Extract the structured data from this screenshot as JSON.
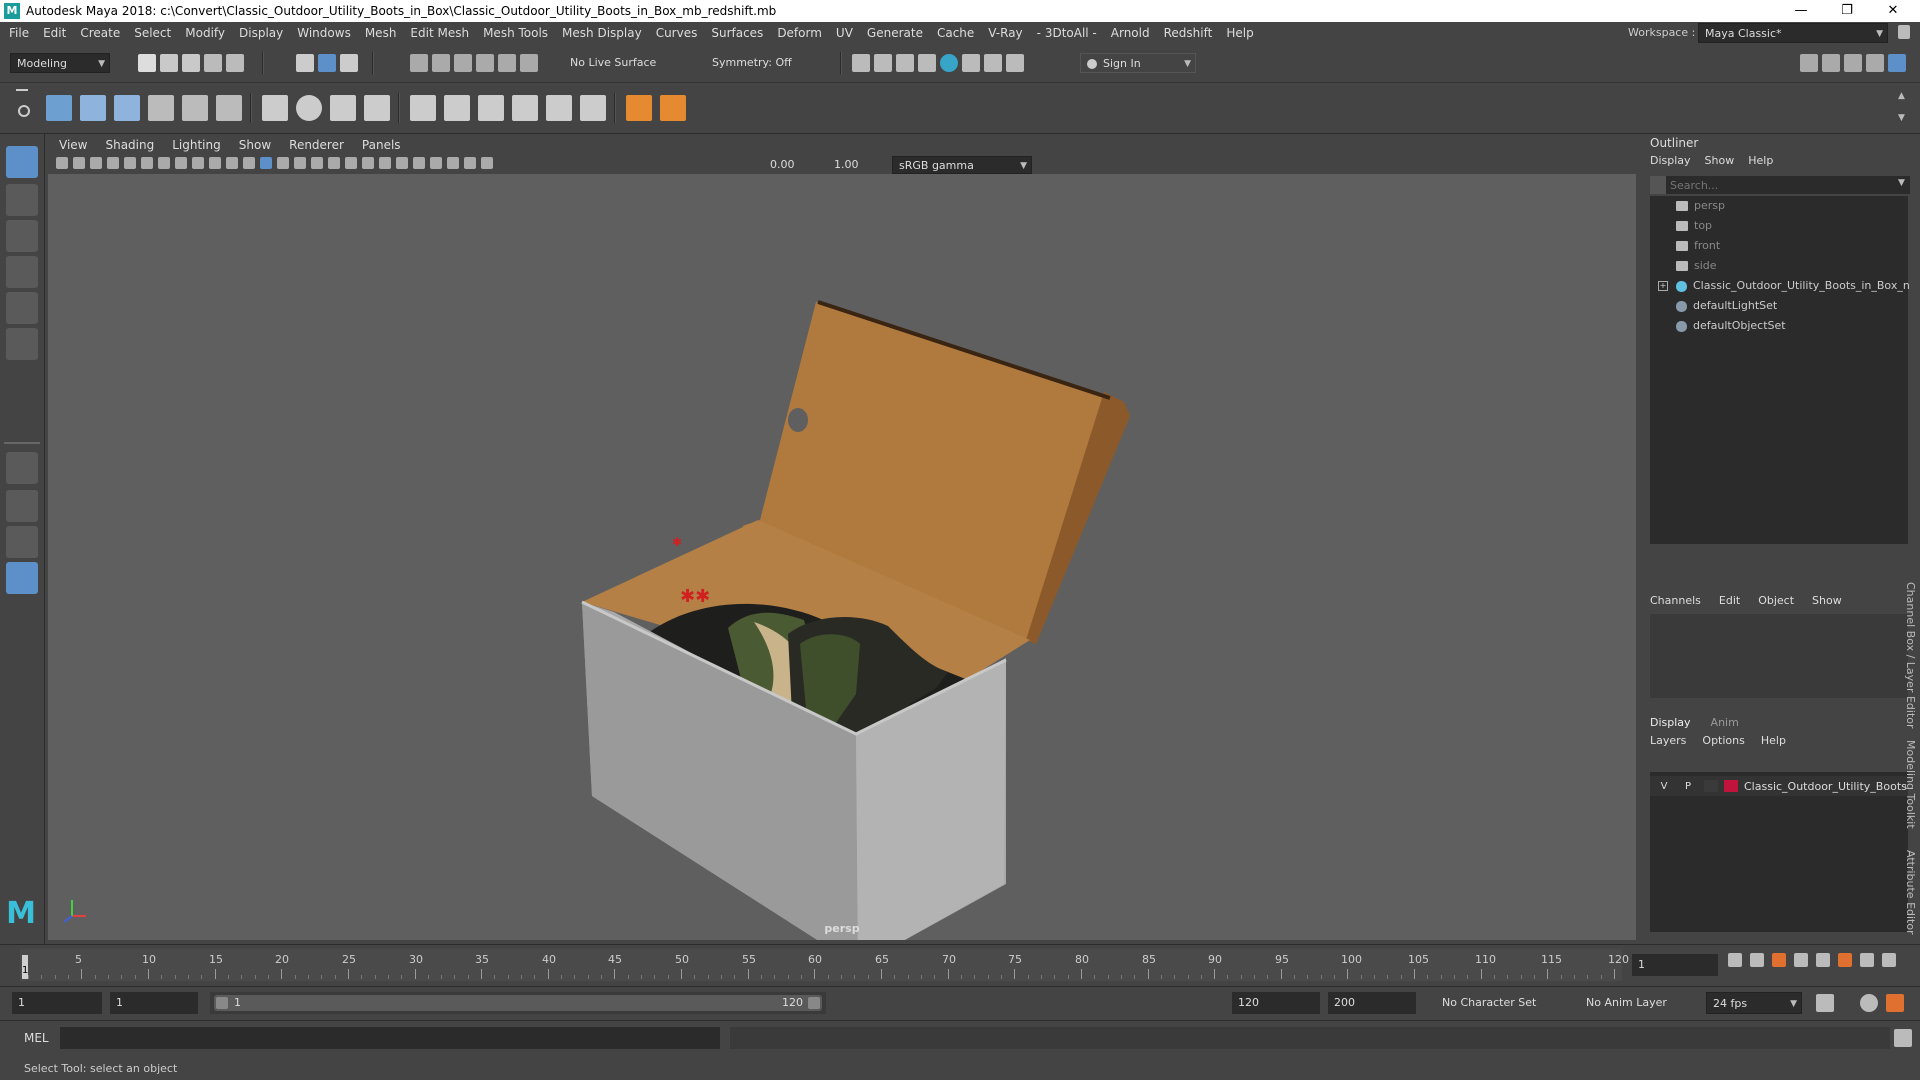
{
  "titlebar": {
    "title": "Autodesk Maya 2018: c:\\Convert\\Classic_Outdoor_Utility_Boots_in_Box\\Classic_Outdoor_Utility_Boots_in_Box_mb_redshift.mb",
    "minimize": "—",
    "maximize": "❐",
    "close": "✕"
  },
  "menubar": {
    "items": [
      "File",
      "Edit",
      "Create",
      "Select",
      "Modify",
      "Display",
      "Windows",
      "Mesh",
      "Edit Mesh",
      "Mesh Tools",
      "Mesh Display",
      "Curves",
      "Surfaces",
      "Deform",
      "UV",
      "Generate",
      "Cache",
      "V-Ray",
      "- 3DtoAll -",
      "Arnold",
      "Redshift",
      "Help"
    ],
    "workspace_label": "Workspace :",
    "workspace_value": "Maya Classic*"
  },
  "toolbar": {
    "mode": "Modeling",
    "live_surface": "No Live Surface",
    "symmetry": "Symmetry: Off",
    "sign_in": "Sign In"
  },
  "viewport": {
    "menu": [
      "View",
      "Shading",
      "Lighting",
      "Show",
      "Renderer",
      "Panels"
    ],
    "exposure": "0.00",
    "gamma": "1.00",
    "color_space": "sRGB gamma",
    "camera_label": "persp"
  },
  "outliner": {
    "title": "Outliner",
    "menu": [
      "Display",
      "Show",
      "Help"
    ],
    "search_placeholder": "Search...",
    "items": [
      "persp",
      "top",
      "front",
      "side",
      "Classic_Outdoor_Utility_Boots_in_Box_n",
      "defaultLightSet",
      "defaultObjectSet"
    ]
  },
  "channelbox": {
    "menu": [
      "Channels",
      "Edit",
      "Object",
      "Show"
    ]
  },
  "layers": {
    "tabs": [
      "Display",
      "Anim"
    ],
    "menu": [
      "Layers",
      "Options",
      "Help"
    ],
    "layer": {
      "v": "V",
      "p": "P",
      "name": "Classic_Outdoor_Utility_Boots",
      "color": "#c0143c"
    }
  },
  "side_tabs": [
    "Channel Box / Layer Editor",
    "Modeling Toolkit",
    "Attribute Editor"
  ],
  "timeline": {
    "ticks": [
      "5",
      "10",
      "15",
      "20",
      "25",
      "30",
      "35",
      "40",
      "45",
      "50",
      "55",
      "60",
      "65",
      "70",
      "75",
      "80",
      "85",
      "90",
      "95",
      "100",
      "105",
      "110",
      "115",
      "120"
    ],
    "current_frame_marker": "1",
    "current_frame": "1"
  },
  "range": {
    "start": "1",
    "playback_start": "1",
    "slider_start": "1",
    "slider_end": "120",
    "playback_end": "120",
    "end": "200",
    "character_set": "No Character Set",
    "anim_layer": "No Anim Layer",
    "fps": "24 fps"
  },
  "cmdline": {
    "label": "MEL"
  },
  "status": {
    "text": "Select Tool: select an object"
  }
}
